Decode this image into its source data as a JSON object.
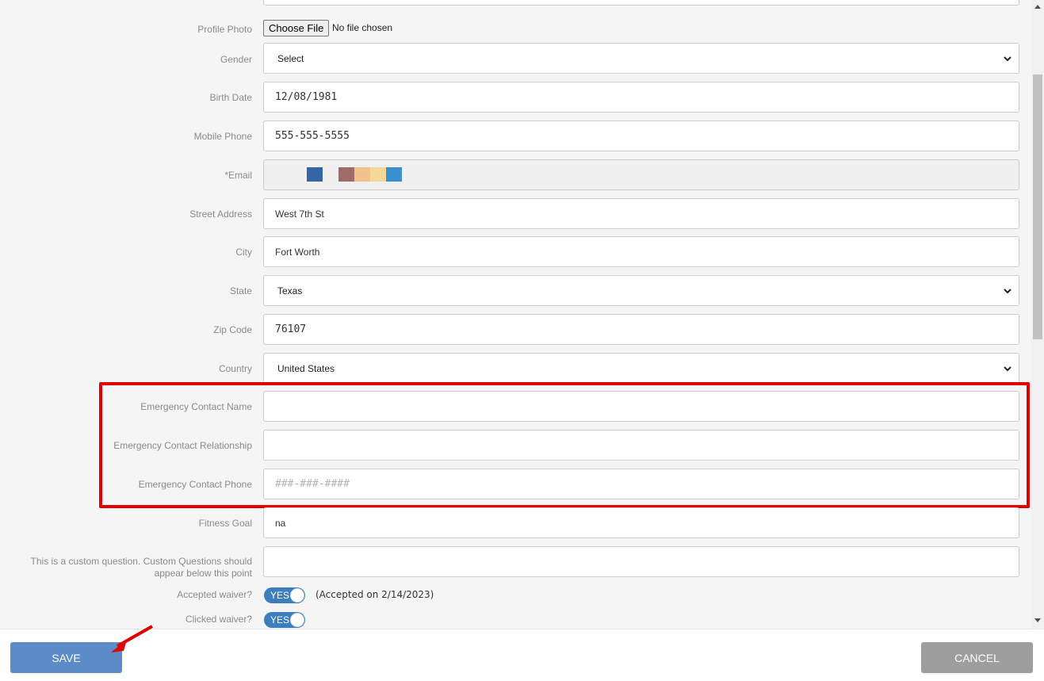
{
  "form": {
    "profile_photo": {
      "label": "Profile Photo",
      "button": "Choose File",
      "status": "No file chosen"
    },
    "gender": {
      "label": "Gender",
      "value": "Select"
    },
    "birth_date": {
      "label": "Birth Date",
      "value": "12/08/1981"
    },
    "mobile_phone": {
      "label": "Mobile Phone",
      "value": "555-555-5555"
    },
    "email": {
      "label": "*Email",
      "swatch_colors": [
        "#3465a4",
        "#a06a6a",
        "#f2c08a",
        "#f4d99a",
        "#3a8fd0"
      ]
    },
    "street_address": {
      "label": "Street Address",
      "value": "West 7th St"
    },
    "city": {
      "label": "City",
      "value": "Fort Worth"
    },
    "state": {
      "label": "State",
      "value": "Texas"
    },
    "zip_code": {
      "label": "Zip Code",
      "value": "76107"
    },
    "country": {
      "label": "Country",
      "value": "United States"
    },
    "emergency_contact_name": {
      "label": "Emergency Contact Name",
      "value": ""
    },
    "emergency_contact_relationship": {
      "label": "Emergency Contact Relationship",
      "value": ""
    },
    "emergency_contact_phone": {
      "label": "Emergency Contact Phone",
      "placeholder": "###-###-####"
    },
    "fitness_goal": {
      "label": "Fitness Goal",
      "value": "na"
    },
    "custom_question": {
      "label_line1": "This is a custom question. Custom Questions should",
      "label_line2": "appear below this point",
      "value": ""
    },
    "accepted_waiver": {
      "label": "Accepted waiver?",
      "toggle": "YES",
      "note": "(Accepted on 2/14/2023)"
    },
    "clicked_waiver": {
      "label": "Clicked waiver?",
      "toggle": "YES"
    }
  },
  "footer": {
    "save_label": "SAVE",
    "cancel_label": "CANCEL"
  },
  "colors": {
    "accent": "#3c7fbf",
    "save": "#5b8cc8",
    "cancel": "#9e9e9e",
    "highlight": "#e00000"
  }
}
